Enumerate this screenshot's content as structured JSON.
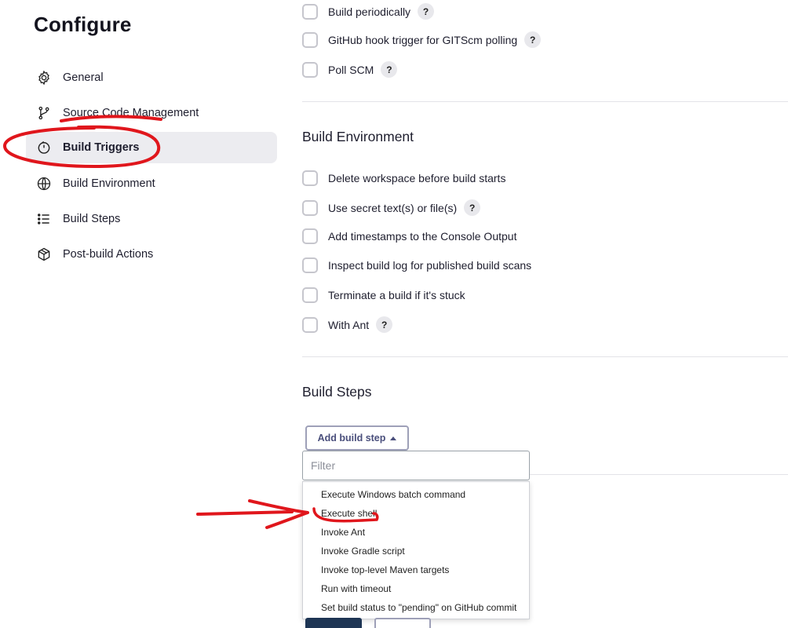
{
  "sidebar": {
    "title": "Configure",
    "items": [
      {
        "label": "General",
        "icon": "gear-icon"
      },
      {
        "label": "Source Code Management",
        "icon": "branch-icon"
      },
      {
        "label": "Build Triggers",
        "icon": "timer-icon",
        "active": true
      },
      {
        "label": "Build Environment",
        "icon": "globe-icon"
      },
      {
        "label": "Build Steps",
        "icon": "list-icon"
      },
      {
        "label": "Post-build Actions",
        "icon": "package-icon"
      }
    ]
  },
  "build_triggers": {
    "options": [
      {
        "label": "Build periodically",
        "help": "?"
      },
      {
        "label": "GitHub hook trigger for GITScm polling",
        "help": "?"
      },
      {
        "label": "Poll SCM",
        "help": "?"
      }
    ]
  },
  "build_environment": {
    "title": "Build Environment",
    "options": [
      {
        "label": "Delete workspace before build starts"
      },
      {
        "label": "Use secret text(s) or file(s)",
        "help": "?"
      },
      {
        "label": "Add timestamps to the Console Output"
      },
      {
        "label": "Inspect build log for published build scans"
      },
      {
        "label": "Terminate a build if it's stuck"
      },
      {
        "label": "With Ant",
        "help": "?"
      }
    ]
  },
  "build_steps": {
    "title": "Build Steps",
    "add_button": "Add build step",
    "filter_placeholder": "Filter",
    "menu_items": [
      "Execute Windows batch command",
      "Execute shell",
      "Invoke Ant",
      "Invoke Gradle script",
      "Invoke top-level Maven targets",
      "Run with timeout",
      "Set build status to \"pending\" on GitHub commit"
    ]
  },
  "colors": {
    "annotation": "#e0161c",
    "active_bg": "#ececf0",
    "save_button": "#1e3554"
  }
}
